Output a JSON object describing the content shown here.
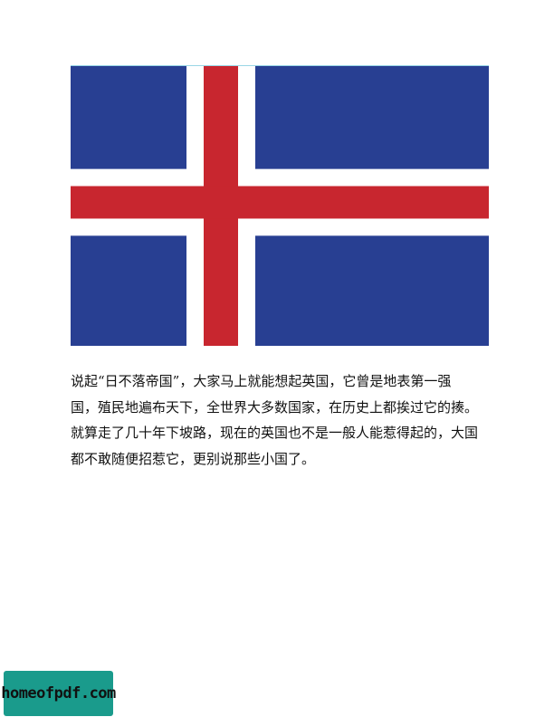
{
  "document": {
    "flag_image": {
      "alt": "Icelandic flag",
      "colors": {
        "blue": "#283f92",
        "white": "#ffffff",
        "red": "#c8262f"
      }
    },
    "paragraph_lines": [
      "说起“日不落帝国”，大家马上就能想起英国，它曾是地表第一强",
      "国，殖民地遍布天下，全世界大多数国家，在历史上都挨过它的揍。",
      "就算走了几十年下坡路，现在的英国也不是一般人能惹得起的，大国",
      "都不敢随便招惹它，更别说那些小国了。"
    ]
  },
  "watermark": {
    "text": "homeofpdf.com",
    "background": "#1a9b8c"
  }
}
